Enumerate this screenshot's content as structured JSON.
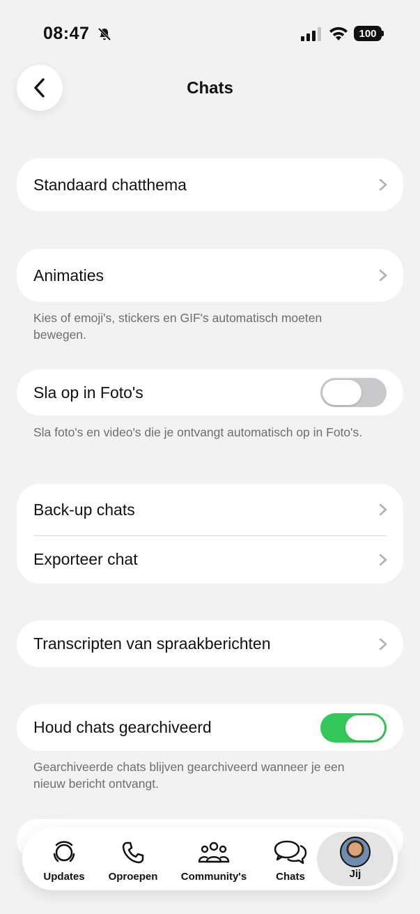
{
  "status_bar": {
    "time": "08:47",
    "battery": "100"
  },
  "header": {
    "title": "Chats"
  },
  "sections": {
    "theme": {
      "label": "Standaard chatthema"
    },
    "animations": {
      "label": "Animaties",
      "footnote": "Kies of emoji's, stickers en GIF's automatisch moeten bewegen."
    },
    "save_photos": {
      "label": "Sla op in Foto's",
      "toggle_on": false,
      "footnote": "Sla foto's en video's die je ontvangt automatisch op in Foto's."
    },
    "backup": {
      "label": "Back-up chats"
    },
    "export": {
      "label": "Exporteer chat"
    },
    "transcripts": {
      "label": "Transcripten van spraakberichten"
    },
    "archived": {
      "label": "Houd chats gearchiveerd",
      "toggle_on": true,
      "footnote": "Gearchiveerde chats blijven gearchiveerd wanneer je een nieuw bericht ontvangt."
    }
  },
  "tabbar": {
    "items": [
      {
        "label": "Updates",
        "icon": "updates-icon"
      },
      {
        "label": "Oproepen",
        "icon": "phone-icon"
      },
      {
        "label": "Community's",
        "icon": "community-icon"
      },
      {
        "label": "Chats",
        "icon": "chats-icon"
      },
      {
        "label": "Jij",
        "icon": "avatar",
        "active": true
      }
    ]
  },
  "colors": {
    "background": "#f2f2f2",
    "toggle_on": "#34c759",
    "toggle_off": "#c9c9cc",
    "footnote": "#6d6d72"
  }
}
